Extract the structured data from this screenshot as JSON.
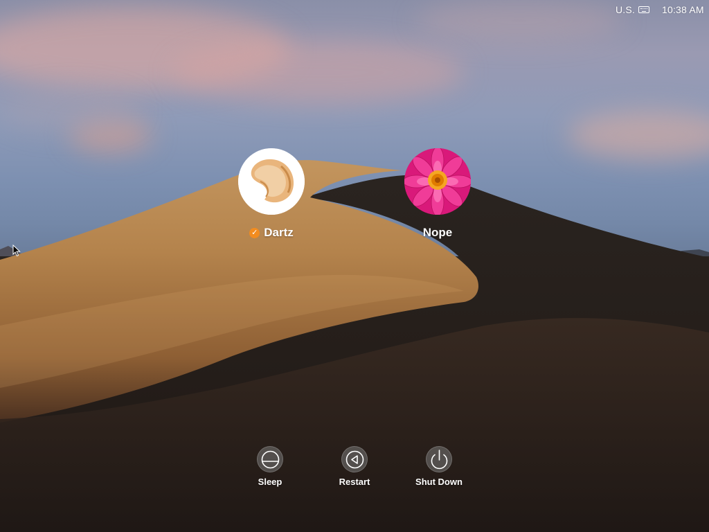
{
  "menu_bar": {
    "input_source_label": "U.S.",
    "input_source_icon": "keyboard-icon",
    "clock": "10:38 AM"
  },
  "users": [
    {
      "name": "Dartz",
      "avatar": "fortune-cookie",
      "logged_in": true,
      "badge_icon": "checkmark-icon",
      "badge_color": "#f28c1f"
    },
    {
      "name": "Nope",
      "avatar": "pink-flower",
      "logged_in": false
    }
  ],
  "power_buttons": [
    {
      "label": "Sleep",
      "icon": "sleep-icon"
    },
    {
      "label": "Restart",
      "icon": "restart-icon"
    },
    {
      "label": "Shut Down",
      "icon": "power-icon"
    }
  ],
  "colors": {
    "accent_badge": "#f28c1f",
    "text": "#ffffff",
    "button_fill": "#787878"
  }
}
